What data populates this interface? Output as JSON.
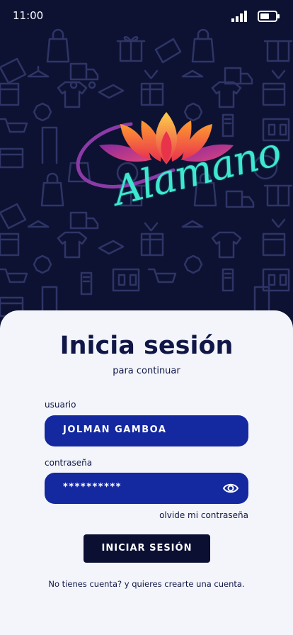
{
  "status": {
    "time": "11:00"
  },
  "brand": {
    "name": "Alamano"
  },
  "login": {
    "title": "Inicia sesión",
    "subtitle": "para continuar",
    "username_label": "usuario",
    "username_value": "JOLMAN GAMBOA",
    "password_label": "contraseña",
    "password_value": "**********",
    "forgot_link": "olvide mi contraseña",
    "submit_label": "INICIAR SESIÓN",
    "signup_text": "No tienes cuenta? y quieres crearte una cuenta."
  },
  "colors": {
    "hero_bg": "#0d1233",
    "card_bg": "#f3f5fa",
    "field_bg": "#1428a0",
    "button_bg": "#0b1033",
    "logo_teal": "#3ee8d0",
    "logo_magenta": "#d23a9a"
  },
  "icons": [
    "signal-icon",
    "battery-icon",
    "eye-icon",
    "shopping-pattern"
  ]
}
